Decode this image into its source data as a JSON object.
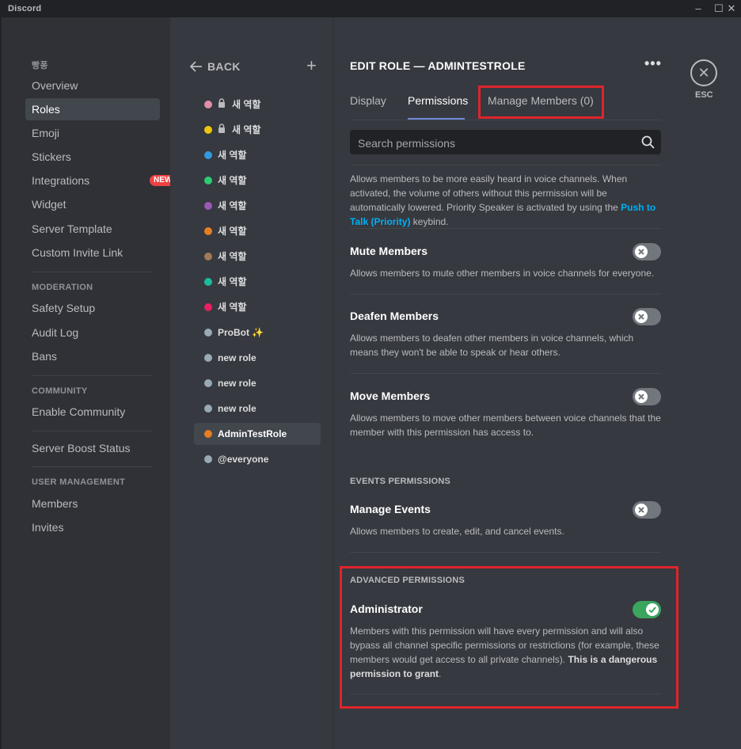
{
  "app": {
    "title": "Discord"
  },
  "window": {
    "minimize": "–",
    "maximize": "☐",
    "close": "✕"
  },
  "sidebar": {
    "server_name": "빵퐁",
    "items": [
      {
        "label": "Overview"
      },
      {
        "label": "Roles",
        "selected": true
      },
      {
        "label": "Emoji"
      },
      {
        "label": "Stickers"
      },
      {
        "label": "Integrations",
        "badge": "NEW"
      },
      {
        "label": "Widget"
      },
      {
        "label": "Server Template"
      },
      {
        "label": "Custom Invite Link"
      }
    ],
    "moderation": {
      "heading": "MODERATION",
      "items": [
        {
          "label": "Safety Setup"
        },
        {
          "label": "Audit Log"
        },
        {
          "label": "Bans"
        }
      ]
    },
    "community": {
      "heading": "COMMUNITY",
      "items": [
        {
          "label": "Enable Community"
        }
      ]
    },
    "boost": {
      "label": "Server Boost Status"
    },
    "user_management": {
      "heading": "USER MANAGEMENT",
      "items": [
        {
          "label": "Members"
        },
        {
          "label": "Invites"
        }
      ]
    }
  },
  "roles_panel": {
    "back_label": "BACK",
    "add_label": "+",
    "roles": [
      {
        "name": "새 역할",
        "color": "#e28ea7",
        "locked": true
      },
      {
        "name": "새 역할",
        "color": "#f1c40f",
        "locked": true
      },
      {
        "name": "새 역할",
        "color": "#3498db"
      },
      {
        "name": "새 역할",
        "color": "#2ecc71"
      },
      {
        "name": "새 역할",
        "color": "#9b59b6"
      },
      {
        "name": "새 역할",
        "color": "#e67e22"
      },
      {
        "name": "새 역할",
        "color": "#a0785a"
      },
      {
        "name": "새 역할",
        "color": "#1abc9c"
      },
      {
        "name": "새 역할",
        "color": "#e91e63"
      },
      {
        "name": "ProBot ✨",
        "color": "#99aab5"
      },
      {
        "name": "new role",
        "color": "#99aab5"
      },
      {
        "name": "new role",
        "color": "#99aab5"
      },
      {
        "name": "new role",
        "color": "#99aab5"
      },
      {
        "name": "AdminTestRole",
        "color": "#e67e22",
        "selected": true
      },
      {
        "name": "@everyone",
        "color": "#99aab5"
      }
    ]
  },
  "editor": {
    "title": "EDIT ROLE — ADMINTESTROLE",
    "more": "•••",
    "close_icon": "✕",
    "esc_label": "ESC",
    "tabs": [
      {
        "label": "Display"
      },
      {
        "label": "Permissions",
        "active": true
      },
      {
        "label": "Manage Members (0)"
      }
    ],
    "search_placeholder": "Search permissions",
    "priority_speaker": {
      "desc_before": "Allows members to be more easily heard in voice channels. When activated, the volume of others without this permission will be automatically lowered. Priority Speaker is activated by using the ",
      "link": "Push to Talk (Priority)",
      "desc_after": " keybind."
    },
    "permissions": [
      {
        "title": "Mute Members",
        "desc": "Allows members to mute other members in voice channels for everyone.",
        "enabled": false
      },
      {
        "title": "Deafen Members",
        "desc": "Allows members to deafen other members in voice channels, which means they won't be able to speak or hear others.",
        "enabled": false
      },
      {
        "title": "Move Members",
        "desc": "Allows members to move other members between voice channels that the member with this permission has access to.",
        "enabled": false
      }
    ],
    "events": {
      "heading": "EVENTS PERMISSIONS",
      "title": "Manage Events",
      "desc": "Allows members to create, edit, and cancel events.",
      "enabled": false
    },
    "advanced": {
      "heading": "ADVANCED PERMISSIONS",
      "title": "Administrator",
      "desc": "Members with this permission will have every permission and will also bypass all channel specific permissions or restrictions (for example, these members would get access to all private channels). ",
      "warning": "This is a dangerous permission to grant",
      "desc_end": ".",
      "enabled": true
    }
  },
  "colors": {
    "accent": "#7289da",
    "toggle_on": "#3ba55d",
    "toggle_off": "#72767d",
    "highlight_box": "#e0242b",
    "badge": "#ed4245",
    "link": "#00aff4"
  }
}
